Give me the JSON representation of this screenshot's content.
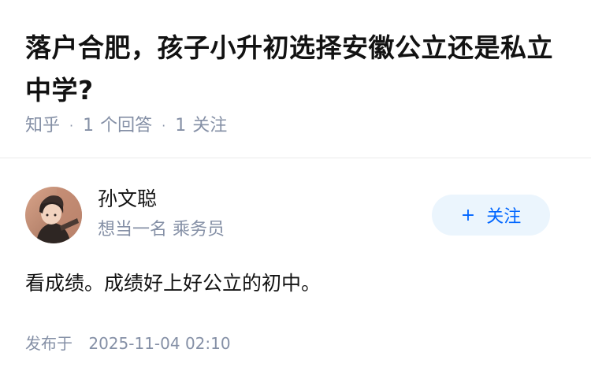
{
  "question": {
    "title": "落户合肥，孩子小升初选择安徽公立还是私立中学?",
    "source": "知乎",
    "answer_count": "1",
    "answer_count_label": "个回答",
    "follow_count": "1",
    "follow_count_label": "关注",
    "separator": "·"
  },
  "answer": {
    "author_name": "孙文聪",
    "author_bio": "想当一名 乘务员",
    "follow_button": {
      "plus": "+",
      "label": "关注"
    },
    "content": "看成绩。成绩好上好公立的初中。",
    "published_label": "发布于",
    "published_time": "2025-11-04 02:10"
  },
  "colors": {
    "accent": "#0066ff",
    "follow_bg": "#ebf5fd",
    "meta": "#8590a6",
    "text": "#121212"
  }
}
